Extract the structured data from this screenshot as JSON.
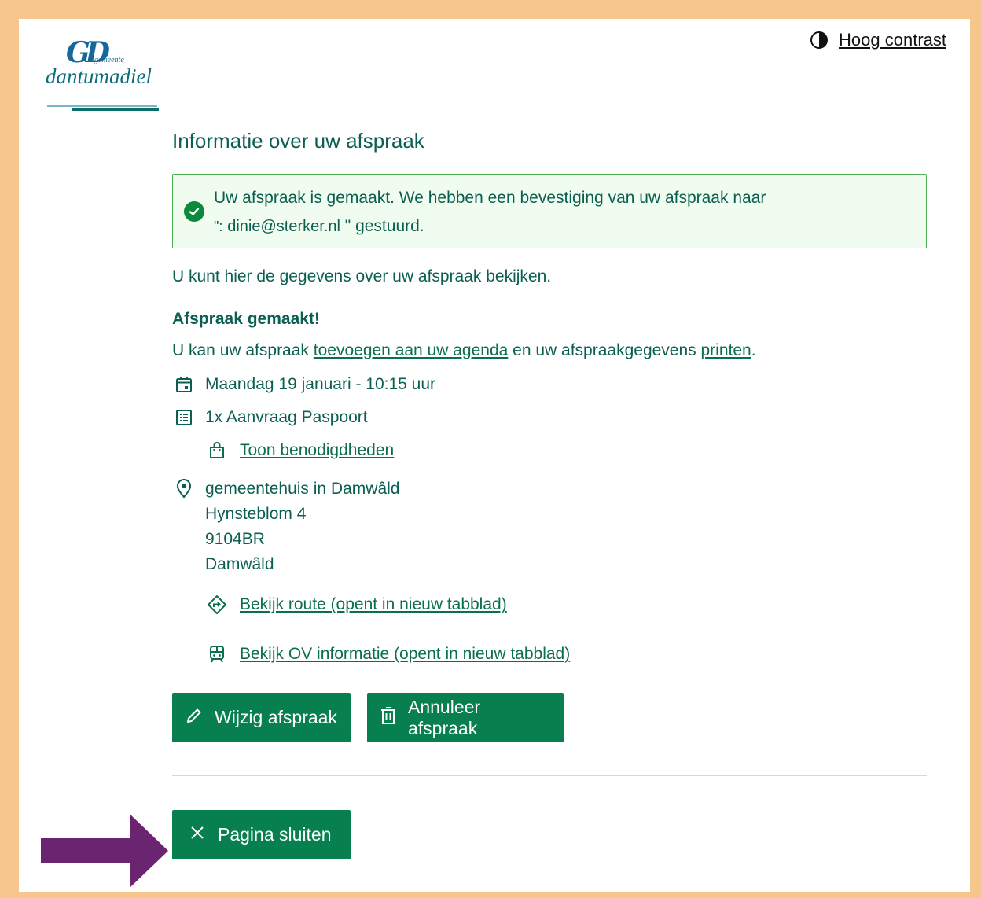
{
  "logo": {
    "mark": "GD",
    "small": "gemeente",
    "name": "dantumadiel"
  },
  "header": {
    "contrast_label": "Hoog contrast"
  },
  "main": {
    "title": "Informatie over uw afspraak",
    "alert": {
      "text1": "Uw afspraak is gemaakt. We hebben een bevestiging van uw afspraak naar",
      "quote_open": "\":",
      "email": "dinie@sterker.nl",
      "text2": "\" gestuurd."
    },
    "intro": "U kunt hier de gegevens over uw afspraak bekijken.",
    "made": "Afspraak gemaakt!",
    "add": {
      "pre": "U kan uw afspraak ",
      "link1": "toevoegen aan uw agenda",
      "mid": " en uw afspraakgegevens ",
      "link2": "printen",
      "post": "."
    },
    "date": "Maandag 19 januari - 10:15 uur",
    "product": "1x Aanvraag Paspoort",
    "requirements_link": "Toon benodigdheden",
    "location": {
      "name": "gemeentehuis in Damwâld",
      "street": "Hynsteblom 4",
      "zip": "9104BR",
      "city": "Damwâld"
    },
    "route_link": "Bekijk route (opent in nieuw tabblad)",
    "ov_link": "Bekijk OV informatie (opent in nieuw tabblad)",
    "buttons": {
      "change": "Wijzig afspraak",
      "cancel": "Annuleer afspraak",
      "close": "Pagina sluiten"
    }
  },
  "colors": {
    "primary": "#077f4e",
    "text": "#0b5f51",
    "frame": "#f7c68f",
    "arrow": "#6b2470",
    "alert_bg": "#f0fcef",
    "alert_border": "#4caf50"
  }
}
